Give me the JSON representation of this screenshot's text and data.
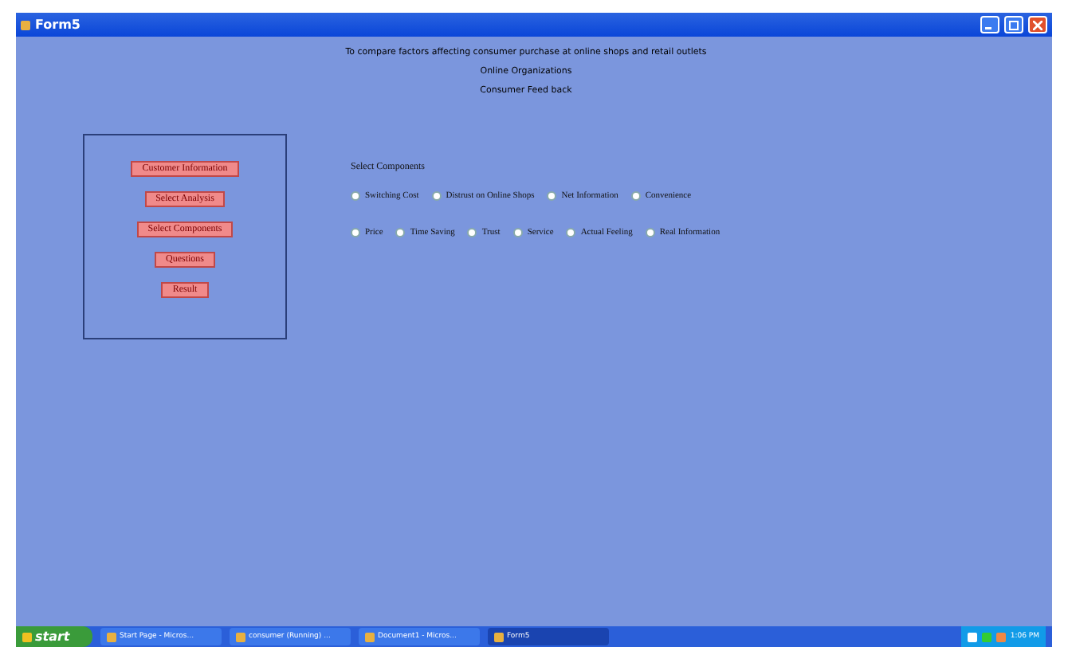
{
  "window": {
    "title": "Form5"
  },
  "header_lines": [
    "To compare factors affecting consumer purchase at online shops and retail outlets",
    "Online Organizations",
    "Consumer  Feed back"
  ],
  "menu_buttons": [
    "Customer Information",
    "Select Analysis",
    "Select Components",
    "Questions",
    "Result"
  ],
  "components": {
    "label": "Select Components",
    "options": [
      {
        "label": "Switching Cost",
        "selected": false
      },
      {
        "label": "Distrust on Online Shops",
        "selected": false
      },
      {
        "label": "Net Information",
        "selected": false
      },
      {
        "label": "Convenience",
        "selected": false
      },
      {
        "label": "Price",
        "selected": false
      },
      {
        "label": "Time Saving",
        "selected": false
      },
      {
        "label": "Trust",
        "selected": false
      },
      {
        "label": "Service",
        "selected": false
      },
      {
        "label": "Actual Feeling",
        "selected": false
      },
      {
        "label": "Real Information",
        "selected": false
      }
    ]
  },
  "taskbar": {
    "start": "start",
    "tasks": [
      {
        "label": "Start Page - Micros...",
        "selected": false
      },
      {
        "label": "consumer (Running) ...",
        "selected": false
      },
      {
        "label": "Document1 - Micros...",
        "selected": false
      },
      {
        "label": "Form5",
        "selected": true
      }
    ],
    "clock": "1:06 PM"
  }
}
